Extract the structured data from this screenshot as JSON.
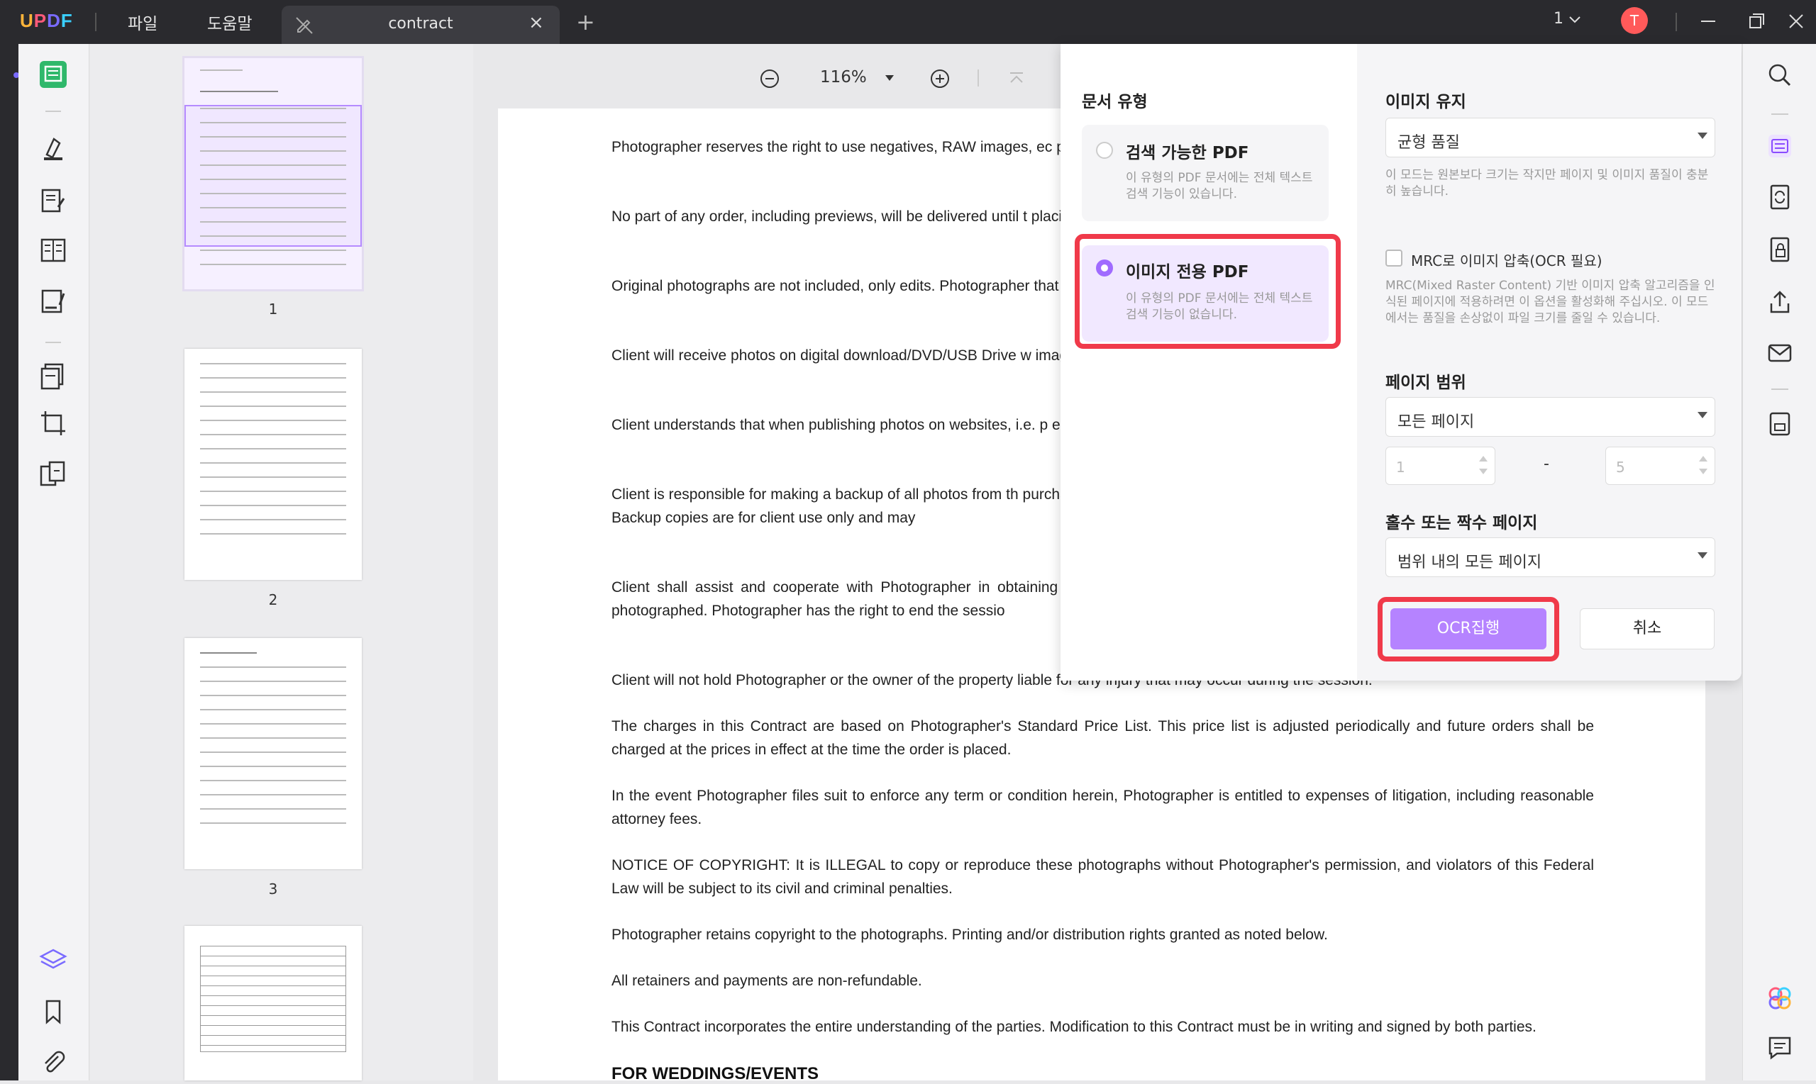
{
  "titlebar": {
    "logo": {
      "u": "U",
      "p": "P",
      "d": "D",
      "f": "F"
    },
    "menu_file": "파일",
    "menu_help": "도움말",
    "tab_title": "contract",
    "page_count_display": "1",
    "avatar_initial": "T"
  },
  "zoom": {
    "value": "116%"
  },
  "thumbnails": [
    {
      "number": "1"
    },
    {
      "number": "2"
    },
    {
      "number": "3"
    }
  ],
  "document": {
    "paragraphs": [
      "Photographer reserves the right to use negatives, RAW images, ec purposes, not restricted to use on the web, Facebook, business car",
      "No part of any order, including previews, will be delivered until t placing an order. Prints will not be ordered until payment is made.",
      "Original photographs are not included, only edits. Photographer that Photographer will not deliver every exposure taken. Client agr",
      "Client will receive photos on digital download/DVD/USB Drive w images for printing and may be used on the web, Facebook, or em",
      "Client understands that when publishing photos on websites, i.e. p editing the watermark, cropping, filters, etc.",
      "Client is responsible for making a backup of all photos from th purchased from Photographer. Photographer will make every atter retained indefinitely. Backup copies are for client use only and may",
      "Client shall assist and cooperate with Photographer in obtaining c not taken as a result of Client's failure to provide reasonable assis being photographed. Photographer has the right to end the sessio",
      "Client will not hold Photographer or the owner of the property liable for any injury that may occur during the session.",
      "The charges in this Contract are based on Photographer's Standard Price List. This price list is adjusted periodically and future orders shall be charged at the prices in effect at the time the order is placed.",
      "In the event Photographer files suit to enforce any term or condition herein, Photographer is entitled to expenses of litigation, including reasonable attorney fees.",
      "NOTICE OF COPYRIGHT: It is ILLEGAL to copy or reproduce these photographs without Photographer's permission, and violators of this Federal Law will be subject to its civil and criminal penalties.",
      "Photographer retains copyright to the photographs. Printing and/or distribution rights granted as noted below.",
      "All retainers and payments are non-refundable.",
      "This Contract incorporates the entire understanding of the parties. Modification to this Contract must be in writing and signed by both parties."
    ],
    "heading": "FOR WEDDINGS/EVENTS"
  },
  "ocr_panel": {
    "doc_type_title": "문서 유형",
    "option_searchable": {
      "title": "검색 가능한 PDF",
      "desc": "이 유형의 PDF 문서에는 전체 텍스트 검색 기능이 있습니다."
    },
    "option_image_only": {
      "title": "이미지 전용 PDF",
      "desc": "이 유형의 PDF 문서에는 전체 텍스트 검색 기능이 없습니다."
    },
    "image_keep_title": "이미지 유지",
    "image_quality_value": "균형 품질",
    "image_quality_desc": "이 모드는 원본보다 크기는 작지만 페이지 및 이미지 품질이 충분히 높습니다.",
    "mrc_label": "MRC로 이미지 압축(OCR 필요)",
    "mrc_desc": "MRC(Mixed Raster Content) 기반 이미지 압축 알고리즘을 인식된 페이지에 적용하려면 이 옵션을 활성화해 주십시오. 이 모드에서는 품질을 손상없이 파일 크기를 줄일 수 있습니다.",
    "page_range_title": "페이지 범위",
    "page_range_value": "모든 페이지",
    "range_from": "1",
    "range_dash": "-",
    "range_to": "5",
    "odd_even_title": "홀수 또는 짝수 페이지",
    "odd_even_value": "범위 내의 모든 페이지",
    "run_button": "OCR집행",
    "cancel_button": "취소"
  },
  "colors": {
    "accent": "#b583ff",
    "highlight": "#f03a4a",
    "titlebar": "#2a2a2e"
  }
}
